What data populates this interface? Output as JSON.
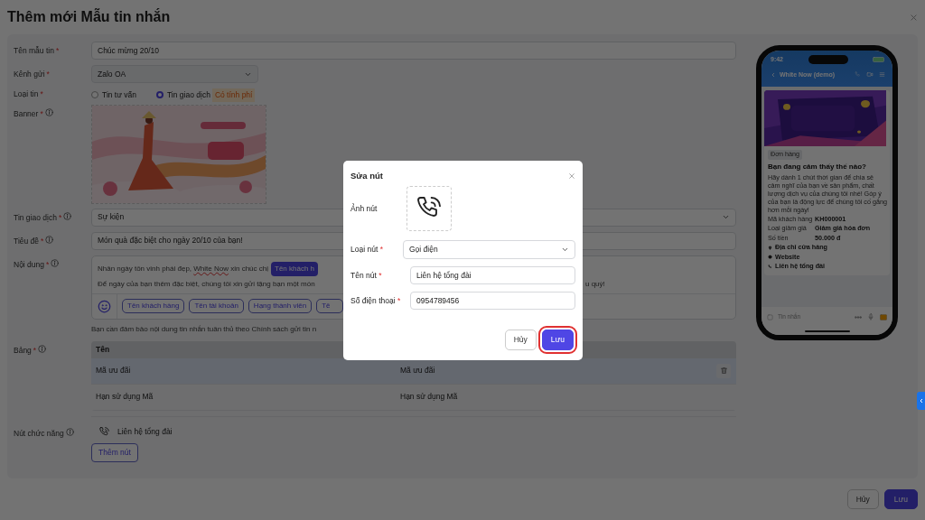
{
  "dialog": {
    "title": "Thêm mới Mẫu tin nhắn"
  },
  "form": [
    {
      "kind": "input",
      "label": "Tên mẫu tin",
      "required_mark": "*",
      "value": "Chúc mừng 20/10"
    },
    {
      "kind": "select",
      "label": "Kênh gửi",
      "required_mark": "*",
      "value": "Zalo OA"
    },
    {
      "kind": "radio",
      "label": "Loại tin",
      "required_mark": "*",
      "options": [
        {
          "label": "Tin tư vấn",
          "selected": false
        },
        {
          "label": "Tin giao dịch",
          "selected": true
        }
      ],
      "badge": "Có tính phí"
    },
    {
      "kind": "banner",
      "label": "Banner",
      "required_mark": "*",
      "info": true
    },
    {
      "kind": "dropdown",
      "label": "Tin giao dịch",
      "required_mark": "*",
      "info": true,
      "value": "Sự kiện"
    },
    {
      "kind": "input",
      "label": "Tiêu đề",
      "required_mark": "*",
      "info": true,
      "value": "Món quà đặc biệt cho ngày 20/10 của bạn!"
    },
    {
      "kind": "content",
      "label": "Nội dung",
      "required_mark": "*",
      "info": true,
      "lines": [
        {
          "parts": [
            {
              "kind": "text",
              "text": "Nhân ngày tôn vinh phái đẹp, "
            },
            {
              "kind": "misspelled",
              "text": "White Now"
            },
            {
              "kind": "text",
              "text": " xin chúc chị"
            }
          ],
          "token": "Tên khách h"
        },
        {
          "parts": [
            {
              "kind": "text",
              "text": "Để ngày của bạn thêm đặc biệt, chúng tôi xin gửi tặng bạn một món"
            }
          ],
          "tail": "u quý!"
        }
      ],
      "chips": [
        "Tên khách hàng",
        "Tên tài khoản",
        "Hạng thành viên",
        "Tê"
      ],
      "notice": "Bạn cần đảm bảo nội dung tin nhắn tuân thủ theo",
      "notice_link": "Chính sách gửi tin n"
    },
    {
      "kind": "table",
      "label": "Bảng",
      "required_mark": "*",
      "info": true,
      "columns": [
        "Tên"
      ],
      "rows": [
        {
          "cells": [
            "Mã ưu đãi",
            "Mã ưu đãi"
          ],
          "hovered": true
        },
        {
          "cells": [
            "Hạn sử dụng Mã",
            "Hạn sử dụng Mã"
          ],
          "hovered": false
        }
      ]
    },
    {
      "kind": "buttons",
      "label": "Nút chức năng",
      "info": true,
      "items": [
        {
          "label": "Liên hệ tổng đài"
        }
      ],
      "add_button": "Thêm nút"
    }
  ],
  "preview": {
    "time": "9:42",
    "chat_title": "White Now (demo)",
    "tag": "Đơn hàng",
    "title": "Bạn đang cảm thấy thế nào?",
    "description": "Hãy dành 1 chút thời gian để chia sẻ cảm nghĩ của bạn về sản phẩm, chất lượng dịch vụ của chúng tôi nhé! Góp ý của bạn là động lực để chúng tôi cố gắng hơn mỗi ngày!",
    "details": [
      {
        "label": "Mã khách hàng",
        "value": "KH000001"
      },
      {
        "label": "Loại giảm giá",
        "value": "Giảm giá hóa đơn"
      },
      {
        "label": "Số tiền",
        "value": "50.000 đ"
      }
    ],
    "actions": [
      {
        "kind": "location",
        "label": "Địa chỉ cửa hàng"
      },
      {
        "kind": "web",
        "label": "Website"
      },
      {
        "kind": "phone",
        "label": "Liên hệ tổng đài"
      }
    ],
    "composer_placeholder": "Tin nhắn"
  },
  "footer_buttons": [
    {
      "kind": "secondary",
      "label": "Hủy"
    },
    {
      "kind": "primary",
      "label": "Lưu"
    }
  ],
  "modal": {
    "title": "Sửa nút",
    "image_label": "Ảnh nút",
    "fields": [
      {
        "kind": "select",
        "label": "Loại nút",
        "required_mark": "*",
        "value": "Gọi điện"
      },
      {
        "kind": "input",
        "label": "Tên nút",
        "required_mark": "*",
        "value": "Liên hệ tổng đài"
      },
      {
        "kind": "input",
        "label": "Số điện thoại",
        "required_mark": "*",
        "value": "0954789456"
      }
    ],
    "buttons": [
      {
        "kind": "secondary",
        "label": "Hủy",
        "highlighted": false
      },
      {
        "kind": "primary",
        "label": "Lưu",
        "highlighted": true
      }
    ]
  }
}
